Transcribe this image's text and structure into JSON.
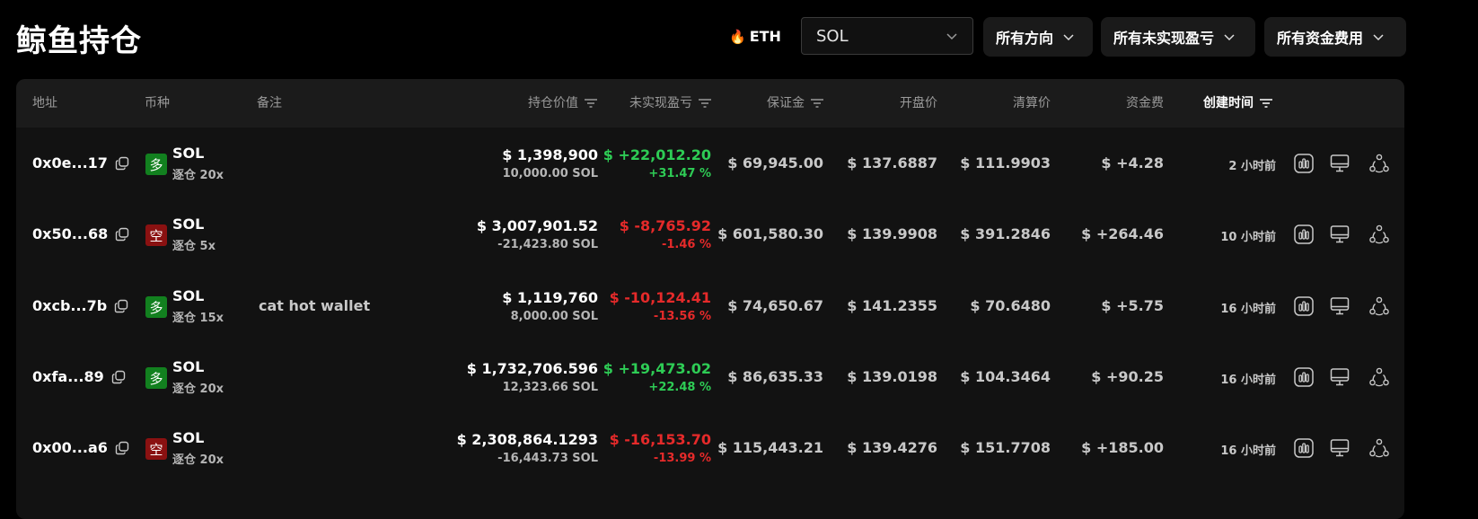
{
  "page_title": "鲸鱼持仓",
  "filters": {
    "eth_chip": "ETH",
    "coin_select": "SOL",
    "direction": "所有方向",
    "unrealized": "所有未实现盈亏",
    "funding": "所有资金费用"
  },
  "columns": {
    "address": "地址",
    "coin": "币种",
    "note": "备注",
    "position_value": "持仓价值",
    "unrealized_pnl": "未实现盈亏",
    "margin": "保证金",
    "entry_price": "开盘价",
    "liq_price": "清算价",
    "funding": "资金费",
    "created": "创建时间"
  },
  "colors": {
    "positive": "#2ecc55",
    "negative": "#e52a2a",
    "long_badge": "#12801f",
    "short_badge": "#8a1111"
  },
  "rows": [
    {
      "address": "0x0e...17",
      "side": "多",
      "side_type": "long",
      "coin": "SOL",
      "leverage": "逐仓 20x",
      "note": "",
      "value": "$ 1,398,900",
      "size": "10,000.00 SOL",
      "pnl": "$ +22,012.20",
      "pnl_pct": "+31.47 %",
      "pnl_type": "pos",
      "margin": "$ 69,945.00",
      "entry": "$ 137.6887",
      "liq": "$ 111.9903",
      "funding": "$ +4.28",
      "created": "2 小时前"
    },
    {
      "address": "0x50...68",
      "side": "空",
      "side_type": "short",
      "coin": "SOL",
      "leverage": "逐仓 5x",
      "note": "",
      "value": "$ 3,007,901.52",
      "size": "-21,423.80 SOL",
      "pnl": "$ -8,765.92",
      "pnl_pct": "-1.46 %",
      "pnl_type": "neg",
      "margin": "$ 601,580.30",
      "entry": "$ 139.9908",
      "liq": "$ 391.2846",
      "funding": "$ +264.46",
      "created": "10 小时前"
    },
    {
      "address": "0xcb...7b",
      "side": "多",
      "side_type": "long",
      "coin": "SOL",
      "leverage": "逐仓 15x",
      "note": "cat hot wallet",
      "value": "$ 1,119,760",
      "size": "8,000.00 SOL",
      "pnl": "$ -10,124.41",
      "pnl_pct": "-13.56 %",
      "pnl_type": "neg",
      "margin": "$ 74,650.67",
      "entry": "$ 141.2355",
      "liq": "$ 70.6480",
      "funding": "$ +5.75",
      "created": "16 小时前"
    },
    {
      "address": "0xfa...89",
      "side": "多",
      "side_type": "long",
      "coin": "SOL",
      "leverage": "逐仓 20x",
      "note": "",
      "value": "$ 1,732,706.596",
      "size": "12,323.66 SOL",
      "pnl": "$ +19,473.02",
      "pnl_pct": "+22.48 %",
      "pnl_type": "pos",
      "margin": "$ 86,635.33",
      "entry": "$ 139.0198",
      "liq": "$ 104.3464",
      "funding": "$ +90.25",
      "created": "16 小时前"
    },
    {
      "address": "0x00...a6",
      "side": "空",
      "side_type": "short",
      "coin": "SOL",
      "leverage": "逐仓 20x",
      "note": "",
      "value": "$ 2,308,864.1293",
      "size": "-16,443.73 SOL",
      "pnl": "$ -16,153.70",
      "pnl_pct": "-13.99 %",
      "pnl_type": "neg",
      "margin": "$ 115,443.21",
      "entry": "$ 139.4276",
      "liq": "$ 151.7708",
      "funding": "$ +185.00",
      "created": "16 小时前"
    }
  ],
  "row_actions": [
    "chart-icon",
    "monitor-icon",
    "share-network-icon"
  ]
}
